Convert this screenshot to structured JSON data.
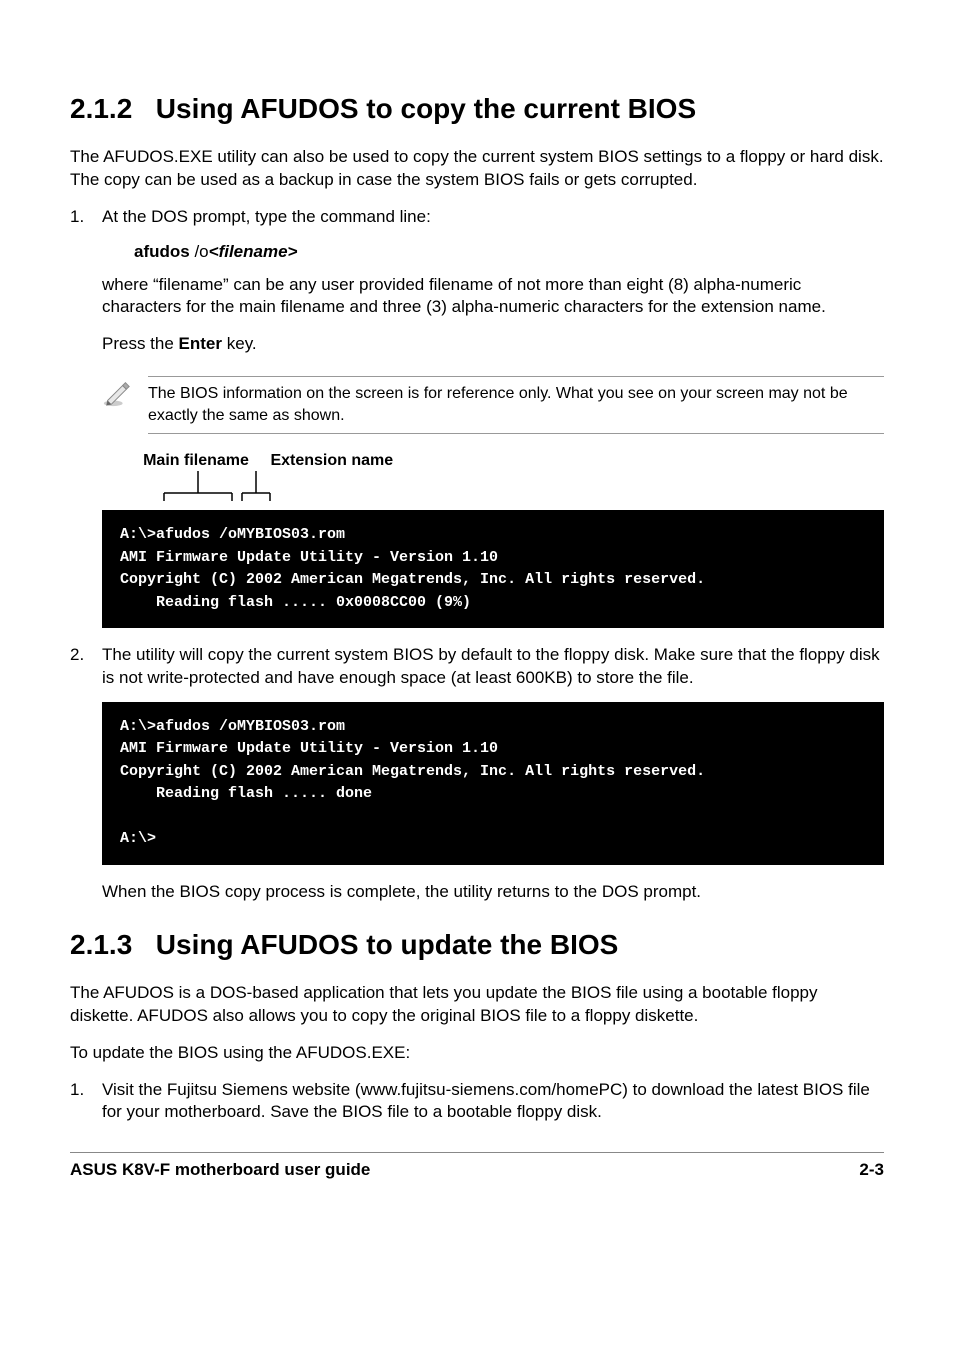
{
  "section212": {
    "num": "2.1.2",
    "title": "Using AFUDOS to copy the current BIOS",
    "intro": "The AFUDOS.EXE utility can also be used to copy the current system BIOS settings to a floppy or hard disk. The copy can be used as a backup in case the system BIOS fails or gets corrupted.",
    "step1_num": "1.",
    "step1": "At the DOS prompt, type the command line:",
    "cmd_afudos": "afudos",
    "cmd_slash": " /o",
    "cmd_filename": "<filename>",
    "where_text": "where “filename” can be any user provided filename of not more than eight (8) alpha-numeric characters for the main filename and three (3) alpha-numeric characters for the extension name.",
    "press_pre": "Press the ",
    "press_key": "Enter",
    "press_post": " key.",
    "note": "The BIOS information on the screen is for reference only. What you see on your screen may not be exactly the same as shown.",
    "label_main": "Main filename",
    "label_ext": "Extension name",
    "terminal1": "A:\\>afudos /oMYBIOS03.rom\nAMI Firmware Update Utility - Version 1.10\nCopyright (C) 2002 American Megatrends, Inc. All rights reserved.\n    Reading flash ..... 0x0008CC00 (9%)",
    "step2_num": "2.",
    "step2": "The utility will copy the current system BIOS by default to the floppy disk. Make sure that the floppy disk is not write-protected and have enough space (at least 600KB) to store the file.",
    "terminal2": "A:\\>afudos /oMYBIOS03.rom\nAMI Firmware Update Utility - Version 1.10\nCopyright (C) 2002 American Megatrends, Inc. All rights reserved.\n    Reading flash ..... done\n\nA:\\>",
    "complete": "When the BIOS copy process is complete, the utility returns to the DOS prompt."
  },
  "section213": {
    "num": "2.1.3",
    "title": "Using AFUDOS to update the BIOS",
    "intro": "The AFUDOS is a DOS-based application that lets you update the BIOS file using a bootable floppy diskette. AFUDOS also allows you to copy the original BIOS file to a floppy diskette.",
    "toUpdate": "To update the BIOS using the AFUDOS.EXE:",
    "step1_num": "1.",
    "step1": "Visit the Fujitsu Siemens website (www.fujitsu-siemens.com/homePC) to download the latest BIOS file for your motherboard. Save the BIOS file to a bootable floppy disk."
  },
  "footer": {
    "left": "ASUS K8V-F motherboard user guide",
    "right": "2-3"
  }
}
